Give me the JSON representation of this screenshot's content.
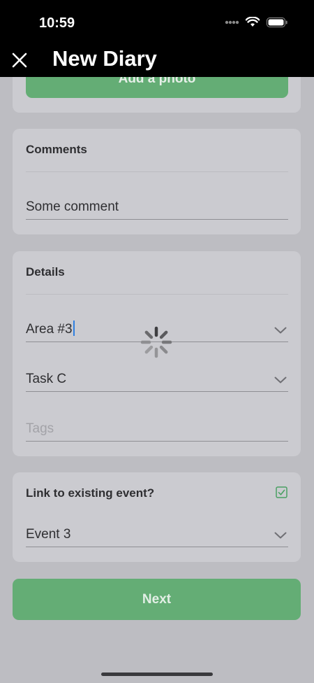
{
  "status_bar": {
    "time": "10:59"
  },
  "header": {
    "title": "New Diary"
  },
  "photo": {
    "button_label": "Add a photo"
  },
  "comments": {
    "label": "Comments",
    "value": "Some comment"
  },
  "details": {
    "label": "Details",
    "area": "Area #3",
    "task": "Task C",
    "tags_placeholder": "Tags"
  },
  "link_event": {
    "label": "Link to existing event?",
    "checked": true,
    "event": "Event 3"
  },
  "footer": {
    "next_label": "Next"
  },
  "colors": {
    "accent_green": "#64ad75",
    "checkbox_green": "#4aa062"
  },
  "icons": [
    "close-icon",
    "chevron-down-icon",
    "checkbox-icon",
    "loading-spinner-icon",
    "wifi-icon",
    "battery-icon",
    "signal-icon"
  ]
}
